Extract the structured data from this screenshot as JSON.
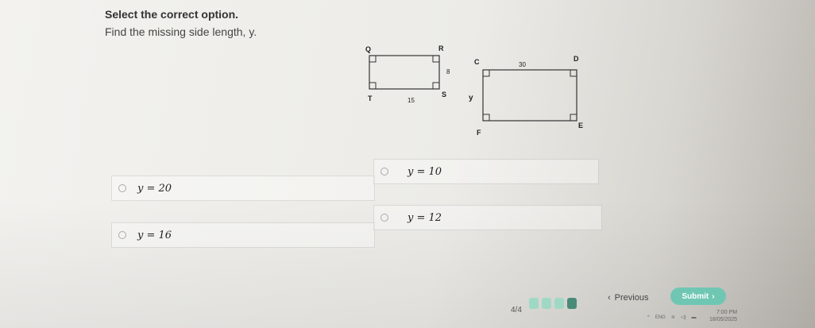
{
  "question": {
    "heading": "Select the correct option.",
    "prompt": "Find the missing side length, y."
  },
  "figure": {
    "small_rect": {
      "labels": {
        "Q": "Q",
        "R": "R",
        "T": "T",
        "S": "S"
      },
      "side_right": "8",
      "side_bottom": "15"
    },
    "large_rect": {
      "labels": {
        "C": "C",
        "D": "D",
        "F": "F",
        "E": "E"
      },
      "side_top": "30",
      "side_left": "y"
    }
  },
  "options": [
    {
      "id": "a",
      "text": "y = 20"
    },
    {
      "id": "b",
      "text": "y = 10"
    },
    {
      "id": "c",
      "text": "y = 16"
    },
    {
      "id": "d",
      "text": "y = 12"
    }
  ],
  "footer": {
    "progress": "4/4",
    "progress_colors": [
      "#9fd9c6",
      "#9fd9c6",
      "#9fd9c6",
      "#4a8a78"
    ],
    "previous_label": "Previous",
    "submit_label": "Submit",
    "accent_color": "#6fc7b3"
  },
  "taskbar": {
    "lang": "ENG",
    "time": "7:00 PM",
    "date": "18/05/2025"
  }
}
